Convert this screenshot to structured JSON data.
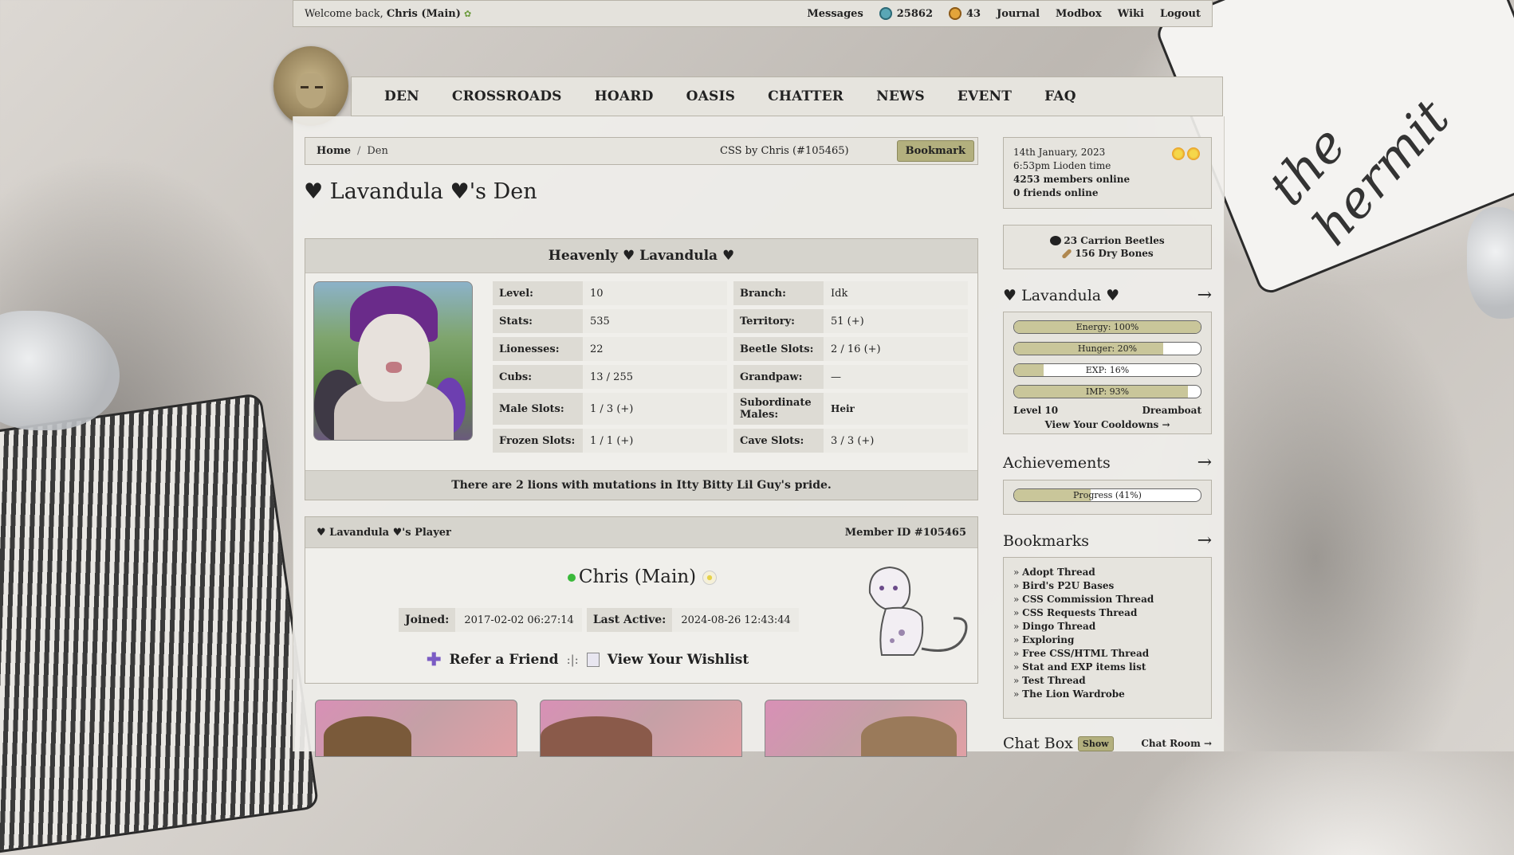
{
  "topbar": {
    "welcome_prefix": "Welcome back, ",
    "username": "Chris (Main)",
    "messages": "Messages",
    "beetles": "25862",
    "gold_beetles": "43",
    "journal": "Journal",
    "modbox": "Modbox",
    "wiki": "Wiki",
    "logout": "Logout"
  },
  "nav": [
    "DEN",
    "CROSSROADS",
    "HOARD",
    "OASIS",
    "CHATTER",
    "NEWS",
    "EVENT",
    "FAQ"
  ],
  "breadcrumb": {
    "home": "Home",
    "sep": "/",
    "current": "Den",
    "css_credit": "CSS by Chris (#105465)",
    "bookmark": "Bookmark"
  },
  "page_title": "♥ Lavandula ♥'s Den",
  "lion": {
    "name": "Heavenly ♥ Lavandula ♥",
    "stats": [
      [
        {
          "k": "Level:",
          "v": "10"
        },
        {
          "k": "Branch:",
          "v": "Idk"
        }
      ],
      [
        {
          "k": "Stats:",
          "v": "535"
        },
        {
          "k": "Territory:",
          "v": "51 (+)"
        }
      ],
      [
        {
          "k": "Lionesses:",
          "v": "22"
        },
        {
          "k": "Beetle Slots:",
          "v": "2 / 16 (+)"
        }
      ],
      [
        {
          "k": "Cubs:",
          "v": "13 / 255"
        },
        {
          "k": "Grandpaw:",
          "v": "—"
        }
      ],
      [
        {
          "k": "Male Slots:",
          "v": "1 / 3 (+)"
        },
        {
          "k": "Subordinate Males:",
          "v": "Heir"
        }
      ],
      [
        {
          "k": "Frozen Slots:",
          "v": "1 / 1 (+)"
        },
        {
          "k": "Cave Slots:",
          "v": "3 / 3 (+)"
        }
      ]
    ],
    "footer": "There are 2 lions with mutations in Itty Bitty Lil Guy's pride."
  },
  "player": {
    "header": "♥ Lavandula ♥'s Player",
    "member_id": "Member ID #105465",
    "name": "Chris (Main)",
    "joined_label": "Joined:",
    "joined": "2017-02-02 06:27:14",
    "active_label": "Last Active:",
    "active": "2024-08-26 12:43:44",
    "refer": "Refer a Friend",
    "sep": ":|:",
    "wishlist": "View Your Wishlist"
  },
  "sidebar": {
    "date": "14th January, 2023",
    "time": "6:53pm Lioden time",
    "members": "4253 members online",
    "friends": "0 friends online",
    "carrion": "23 Carrion Beetles",
    "bones": "156 Dry Bones",
    "lion_title": "♥ Lavandula ♥",
    "arrow": "→",
    "bars": [
      {
        "label": "Energy: 100%",
        "value": 1.0
      },
      {
        "label": "Hunger: 20%",
        "value": 0.8
      },
      {
        "label": "EXP: 16%",
        "value": 0.16
      },
      {
        "label": "IMP: 93%",
        "value": 0.93
      }
    ],
    "level": "Level 10",
    "rank": "Dreamboat",
    "cooldowns": "View Your Cooldowns →",
    "achievements": "Achievements",
    "progress": {
      "label": "Progress (41%)",
      "value": 0.41
    },
    "bookmarks_title": "Bookmarks",
    "bookmarks": [
      "Adopt Thread",
      "Bird's P2U Bases",
      "CSS Commission Thread",
      "CSS Requests Thread",
      "Dingo Thread",
      "Exploring",
      "Free CSS/HTML Thread",
      "Stat and EXP items list",
      "Test Thread",
      "The Lion Wardrobe"
    ],
    "bullet": "»",
    "chat_title": "Chat Box",
    "chat_show": "Show",
    "chat_room": "Chat Room →"
  },
  "background_text": "the hermit"
}
